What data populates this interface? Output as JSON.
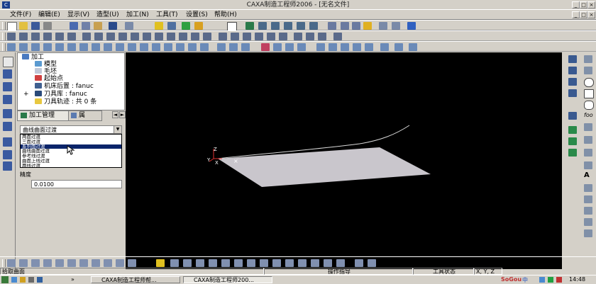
{
  "window": {
    "title": "CAXA制造工程师2006 - [无名文件]"
  },
  "menu": [
    "文件(F)",
    "编辑(E)",
    "显示(V)",
    "造型(U)",
    "加工(N)",
    "工具(T)",
    "设置(S)",
    "帮助(H)"
  ],
  "tree": {
    "root": "加工",
    "items": [
      "模型",
      "毛坯",
      "起始点",
      "机床后置 : fanuc",
      "刀具库 : fanuc",
      "刀具轨迹 : 共 0 条"
    ]
  },
  "tabs": {
    "manage": "加工管理",
    "attr": "属"
  },
  "transition": {
    "selected": "曲线曲面过渡",
    "options": [
      "两面过渡",
      "三面过渡",
      "系列面过渡",
      "曲线曲面过渡",
      "参考线过渡",
      "曲面上线过渡",
      "两线过渡"
    ],
    "highlight_index": 2
  },
  "precision": {
    "label": "精度",
    "value": "0.0100"
  },
  "viewport_axes": {
    "z": "Z",
    "y": "Y",
    "x": "X"
  },
  "statusbar": {
    "prompt": "拾取曲面",
    "cmd": "操作指导",
    "tool_state": "工具状态",
    "coords": "X, Y, Z"
  },
  "taskbar": {
    "btn1": "CAXA制造工程师帮...",
    "btn2": "CAXA制造工程师200...",
    "ime": "中",
    "clock": "14:48",
    "sogou": "SoGou"
  },
  "right_toolbar_text": {
    "foo": "foo",
    "a": "A"
  },
  "colors": {
    "viewport_bg": "#000000",
    "surface": "#c9c6cc",
    "highlight": "#0a246a"
  }
}
